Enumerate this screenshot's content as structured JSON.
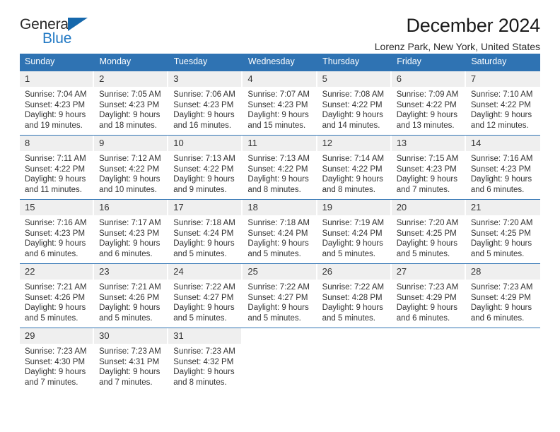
{
  "brand": {
    "word_one": "General",
    "word_two": "Blue",
    "triangle_icon": "triangle-flag-icon",
    "colors": {
      "dark_text": "#2b2b2b",
      "blue_text": "#2279c4",
      "triangle": "#1668ac"
    }
  },
  "header": {
    "title": "December 2024",
    "subtitle": "Lorenz Park, New York, United States"
  },
  "theme": {
    "header_blue": "#2f73b3",
    "daynum_gray": "#efefef",
    "text": "#333333"
  },
  "calendar": {
    "weekday_headers": [
      "Sunday",
      "Monday",
      "Tuesday",
      "Wednesday",
      "Thursday",
      "Friday",
      "Saturday"
    ],
    "labels": {
      "sunrise": "Sunrise:",
      "sunset": "Sunset:",
      "daylight": "Daylight:"
    },
    "weeks": [
      {
        "days": [
          {
            "num": "1",
            "sunrise": "Sunrise: 7:04 AM",
            "sunset": "Sunset: 4:23 PM",
            "daylight_1": "Daylight: 9 hours",
            "daylight_2": "and 19 minutes."
          },
          {
            "num": "2",
            "sunrise": "Sunrise: 7:05 AM",
            "sunset": "Sunset: 4:23 PM",
            "daylight_1": "Daylight: 9 hours",
            "daylight_2": "and 18 minutes."
          },
          {
            "num": "3",
            "sunrise": "Sunrise: 7:06 AM",
            "sunset": "Sunset: 4:23 PM",
            "daylight_1": "Daylight: 9 hours",
            "daylight_2": "and 16 minutes."
          },
          {
            "num": "4",
            "sunrise": "Sunrise: 7:07 AM",
            "sunset": "Sunset: 4:23 PM",
            "daylight_1": "Daylight: 9 hours",
            "daylight_2": "and 15 minutes."
          },
          {
            "num": "5",
            "sunrise": "Sunrise: 7:08 AM",
            "sunset": "Sunset: 4:22 PM",
            "daylight_1": "Daylight: 9 hours",
            "daylight_2": "and 14 minutes."
          },
          {
            "num": "6",
            "sunrise": "Sunrise: 7:09 AM",
            "sunset": "Sunset: 4:22 PM",
            "daylight_1": "Daylight: 9 hours",
            "daylight_2": "and 13 minutes."
          },
          {
            "num": "7",
            "sunrise": "Sunrise: 7:10 AM",
            "sunset": "Sunset: 4:22 PM",
            "daylight_1": "Daylight: 9 hours",
            "daylight_2": "and 12 minutes."
          }
        ]
      },
      {
        "days": [
          {
            "num": "8",
            "sunrise": "Sunrise: 7:11 AM",
            "sunset": "Sunset: 4:22 PM",
            "daylight_1": "Daylight: 9 hours",
            "daylight_2": "and 11 minutes."
          },
          {
            "num": "9",
            "sunrise": "Sunrise: 7:12 AM",
            "sunset": "Sunset: 4:22 PM",
            "daylight_1": "Daylight: 9 hours",
            "daylight_2": "and 10 minutes."
          },
          {
            "num": "10",
            "sunrise": "Sunrise: 7:13 AM",
            "sunset": "Sunset: 4:22 PM",
            "daylight_1": "Daylight: 9 hours",
            "daylight_2": "and 9 minutes."
          },
          {
            "num": "11",
            "sunrise": "Sunrise: 7:13 AM",
            "sunset": "Sunset: 4:22 PM",
            "daylight_1": "Daylight: 9 hours",
            "daylight_2": "and 8 minutes."
          },
          {
            "num": "12",
            "sunrise": "Sunrise: 7:14 AM",
            "sunset": "Sunset: 4:22 PM",
            "daylight_1": "Daylight: 9 hours",
            "daylight_2": "and 8 minutes."
          },
          {
            "num": "13",
            "sunrise": "Sunrise: 7:15 AM",
            "sunset": "Sunset: 4:23 PM",
            "daylight_1": "Daylight: 9 hours",
            "daylight_2": "and 7 minutes."
          },
          {
            "num": "14",
            "sunrise": "Sunrise: 7:16 AM",
            "sunset": "Sunset: 4:23 PM",
            "daylight_1": "Daylight: 9 hours",
            "daylight_2": "and 6 minutes."
          }
        ]
      },
      {
        "days": [
          {
            "num": "15",
            "sunrise": "Sunrise: 7:16 AM",
            "sunset": "Sunset: 4:23 PM",
            "daylight_1": "Daylight: 9 hours",
            "daylight_2": "and 6 minutes."
          },
          {
            "num": "16",
            "sunrise": "Sunrise: 7:17 AM",
            "sunset": "Sunset: 4:23 PM",
            "daylight_1": "Daylight: 9 hours",
            "daylight_2": "and 6 minutes."
          },
          {
            "num": "17",
            "sunrise": "Sunrise: 7:18 AM",
            "sunset": "Sunset: 4:24 PM",
            "daylight_1": "Daylight: 9 hours",
            "daylight_2": "and 5 minutes."
          },
          {
            "num": "18",
            "sunrise": "Sunrise: 7:18 AM",
            "sunset": "Sunset: 4:24 PM",
            "daylight_1": "Daylight: 9 hours",
            "daylight_2": "and 5 minutes."
          },
          {
            "num": "19",
            "sunrise": "Sunrise: 7:19 AM",
            "sunset": "Sunset: 4:24 PM",
            "daylight_1": "Daylight: 9 hours",
            "daylight_2": "and 5 minutes."
          },
          {
            "num": "20",
            "sunrise": "Sunrise: 7:20 AM",
            "sunset": "Sunset: 4:25 PM",
            "daylight_1": "Daylight: 9 hours",
            "daylight_2": "and 5 minutes."
          },
          {
            "num": "21",
            "sunrise": "Sunrise: 7:20 AM",
            "sunset": "Sunset: 4:25 PM",
            "daylight_1": "Daylight: 9 hours",
            "daylight_2": "and 5 minutes."
          }
        ]
      },
      {
        "days": [
          {
            "num": "22",
            "sunrise": "Sunrise: 7:21 AM",
            "sunset": "Sunset: 4:26 PM",
            "daylight_1": "Daylight: 9 hours",
            "daylight_2": "and 5 minutes."
          },
          {
            "num": "23",
            "sunrise": "Sunrise: 7:21 AM",
            "sunset": "Sunset: 4:26 PM",
            "daylight_1": "Daylight: 9 hours",
            "daylight_2": "and 5 minutes."
          },
          {
            "num": "24",
            "sunrise": "Sunrise: 7:22 AM",
            "sunset": "Sunset: 4:27 PM",
            "daylight_1": "Daylight: 9 hours",
            "daylight_2": "and 5 minutes."
          },
          {
            "num": "25",
            "sunrise": "Sunrise: 7:22 AM",
            "sunset": "Sunset: 4:27 PM",
            "daylight_1": "Daylight: 9 hours",
            "daylight_2": "and 5 minutes."
          },
          {
            "num": "26",
            "sunrise": "Sunrise: 7:22 AM",
            "sunset": "Sunset: 4:28 PM",
            "daylight_1": "Daylight: 9 hours",
            "daylight_2": "and 5 minutes."
          },
          {
            "num": "27",
            "sunrise": "Sunrise: 7:23 AM",
            "sunset": "Sunset: 4:29 PM",
            "daylight_1": "Daylight: 9 hours",
            "daylight_2": "and 6 minutes."
          },
          {
            "num": "28",
            "sunrise": "Sunrise: 7:23 AM",
            "sunset": "Sunset: 4:29 PM",
            "daylight_1": "Daylight: 9 hours",
            "daylight_2": "and 6 minutes."
          }
        ]
      },
      {
        "days": [
          {
            "num": "29",
            "sunrise": "Sunrise: 7:23 AM",
            "sunset": "Sunset: 4:30 PM",
            "daylight_1": "Daylight: 9 hours",
            "daylight_2": "and 7 minutes."
          },
          {
            "num": "30",
            "sunrise": "Sunrise: 7:23 AM",
            "sunset": "Sunset: 4:31 PM",
            "daylight_1": "Daylight: 9 hours",
            "daylight_2": "and 7 minutes."
          },
          {
            "num": "31",
            "sunrise": "Sunrise: 7:23 AM",
            "sunset": "Sunset: 4:32 PM",
            "daylight_1": "Daylight: 9 hours",
            "daylight_2": "and 8 minutes."
          },
          {
            "num": "",
            "sunrise": "",
            "sunset": "",
            "daylight_1": "",
            "daylight_2": ""
          },
          {
            "num": "",
            "sunrise": "",
            "sunset": "",
            "daylight_1": "",
            "daylight_2": ""
          },
          {
            "num": "",
            "sunrise": "",
            "sunset": "",
            "daylight_1": "",
            "daylight_2": ""
          },
          {
            "num": "",
            "sunrise": "",
            "sunset": "",
            "daylight_1": "",
            "daylight_2": ""
          }
        ]
      }
    ]
  }
}
